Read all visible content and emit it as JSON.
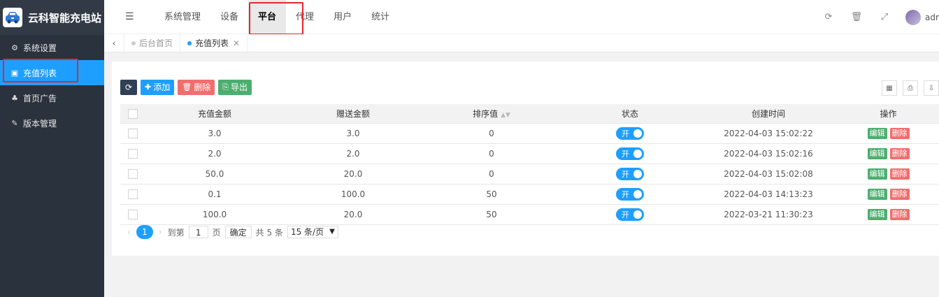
{
  "brand": {
    "title": "云科智能充电站"
  },
  "sidebar": {
    "items": [
      {
        "label": "系统设置",
        "icon": "gears-icon"
      },
      {
        "label": "充值列表",
        "icon": "money-icon",
        "active": true
      },
      {
        "label": "首页广告",
        "icon": "tree-icon"
      },
      {
        "label": "版本管理",
        "icon": "edit-icon"
      }
    ]
  },
  "topnav": {
    "items": [
      {
        "label": "系统管理"
      },
      {
        "label": "设备"
      },
      {
        "label": "平台",
        "active": true
      },
      {
        "label": "代理"
      },
      {
        "label": "用户"
      },
      {
        "label": "统计"
      }
    ],
    "user_name": "admin"
  },
  "tabs": [
    {
      "label": "后台首页"
    },
    {
      "label": "充值列表",
      "active": true
    }
  ],
  "toolbar": {
    "add_label": "添加",
    "delete_label": "删除",
    "export_label": "导出"
  },
  "table": {
    "headers": [
      "充值金额",
      "赠送金额",
      "排序值",
      "状态",
      "创建时间",
      "操作"
    ],
    "rows": [
      {
        "amount": "3.0",
        "gift": "3.0",
        "sort": "0",
        "status": "开",
        "created": "2022-04-03 15:02:22"
      },
      {
        "amount": "2.0",
        "gift": "2.0",
        "sort": "0",
        "status": "开",
        "created": "2022-04-03 15:02:16"
      },
      {
        "amount": "50.0",
        "gift": "20.0",
        "sort": "0",
        "status": "开",
        "created": "2022-04-03 15:02:08"
      },
      {
        "amount": "0.1",
        "gift": "100.0",
        "sort": "50",
        "status": "开",
        "created": "2022-04-03 14:13:23"
      },
      {
        "amount": "100.0",
        "gift": "20.0",
        "sort": "50",
        "status": "开",
        "created": "2022-03-21 11:30:23"
      }
    ],
    "edit_label": "编辑",
    "delete_label": "删除"
  },
  "pager": {
    "current": "1",
    "goto_label": "到第",
    "page_input": "1",
    "page_unit": "页",
    "confirm_label": "确定",
    "total_label": "共 5 条",
    "page_size": "15 条/页"
  },
  "colors": {
    "accent": "#1e9fff",
    "sidebar": "#2a323d",
    "highlight": "#e5262b"
  }
}
